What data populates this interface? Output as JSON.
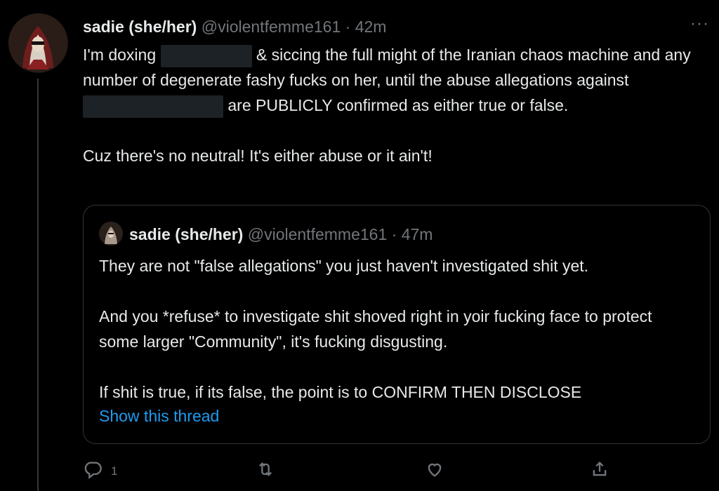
{
  "tweet": {
    "author": {
      "name": "sadie (she/her)",
      "handle": "@violentfemme161",
      "separator": "·",
      "time": "42m"
    },
    "more_label": "···",
    "body": {
      "line1_a": "I'm doxing",
      "line1_b": "& siccing the full might of the Iranian chaos machine and any number of degenerate fashy fucks on her, until the abuse allegations against",
      "line1_c": "are PUBLICLY confirmed as either true or false.",
      "line2": "Cuz there's no neutral! It's either abuse or it ain't!"
    },
    "quote": {
      "author": {
        "name": "sadie (she/her)",
        "handle": "@violentfemme161",
        "separator": "·",
        "time": "47m"
      },
      "para1": "They are not \"false allegations\" you just haven't investigated shit yet.",
      "para2": "And you *refuse* to investigate shit shoved right in yoir fucking face to protect some larger \"Community\", it's fucking disgusting.",
      "para3": "If shit is true, if its false, the point is to CONFIRM THEN DISCLOSE",
      "show_thread": "Show this thread"
    },
    "actions": {
      "reply_count": "1",
      "retweet_count": "",
      "like_count": "",
      "share_count": ""
    }
  },
  "colors": {
    "background": "#000000",
    "text": "#e7e9ea",
    "muted": "#71767b",
    "link": "#1d9bf0",
    "border": "#2f3336",
    "redaction": "#1d2226"
  },
  "icons": [
    "reply-icon",
    "retweet-icon",
    "like-icon",
    "share-icon",
    "more-icon"
  ]
}
